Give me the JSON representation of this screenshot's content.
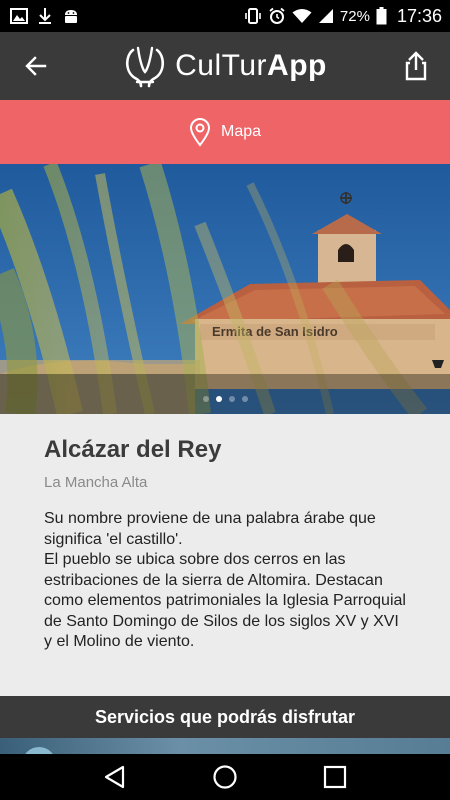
{
  "status_bar": {
    "battery_percent": "72%",
    "time": "17:36",
    "icons": [
      "image-icon",
      "download-icon",
      "android-icon",
      "vibrate-icon",
      "alarm-icon",
      "wifi-icon",
      "signal-icon",
      "battery-icon"
    ]
  },
  "app_bar": {
    "logo_text_light": "CulTur",
    "logo_text_bold": "App",
    "back_icon": "back-arrow-icon",
    "share_icon": "share-icon"
  },
  "map_bar": {
    "label": "Mapa",
    "icon": "location-pin-icon",
    "color": "#ef6467"
  },
  "hero": {
    "sign_text": "Ermita de San Isidro",
    "carousel_total": 4,
    "carousel_active": 2
  },
  "place": {
    "title": "Alcázar del Rey",
    "subtitle": "La Mancha Alta",
    "description_p1": "Su nombre proviene de una palabra árabe que significa 'el castillo'.",
    "description_p2": "El pueblo se ubica sobre dos cerros en las estribaciones de la sierra de Altomira. Destacan como elementos patrimoniales la Iglesia Parroquial de Santo Domingo de Silos de los siglos XV y XVI y el Molino de viento."
  },
  "services": {
    "title": "Servicios que podrás disfrutar"
  },
  "nav_bar": {
    "icons": [
      "nav-back-icon",
      "nav-home-icon",
      "nav-recents-icon"
    ]
  }
}
